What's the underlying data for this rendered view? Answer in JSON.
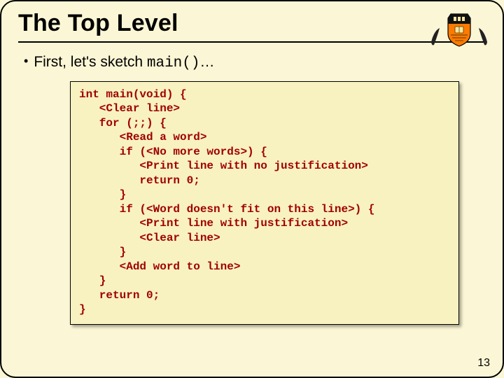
{
  "title": "The Top Level",
  "bullet": {
    "lead": "First, let's sketch ",
    "code": "main()",
    "tail": "…"
  },
  "code_lines": [
    "int main(void) {",
    "   <Clear line>",
    "   for (;;) {",
    "      <Read a word>",
    "      if (<No more words>) {",
    "         <Print line with no justification>",
    "         return 0;",
    "      }",
    "      if (<Word doesn't fit on this line>) {",
    "         <Print line with justification>",
    "         <Clear line>",
    "      }",
    "      <Add word to line>",
    "   }",
    "   return 0;",
    "}"
  ],
  "page_number": "13"
}
